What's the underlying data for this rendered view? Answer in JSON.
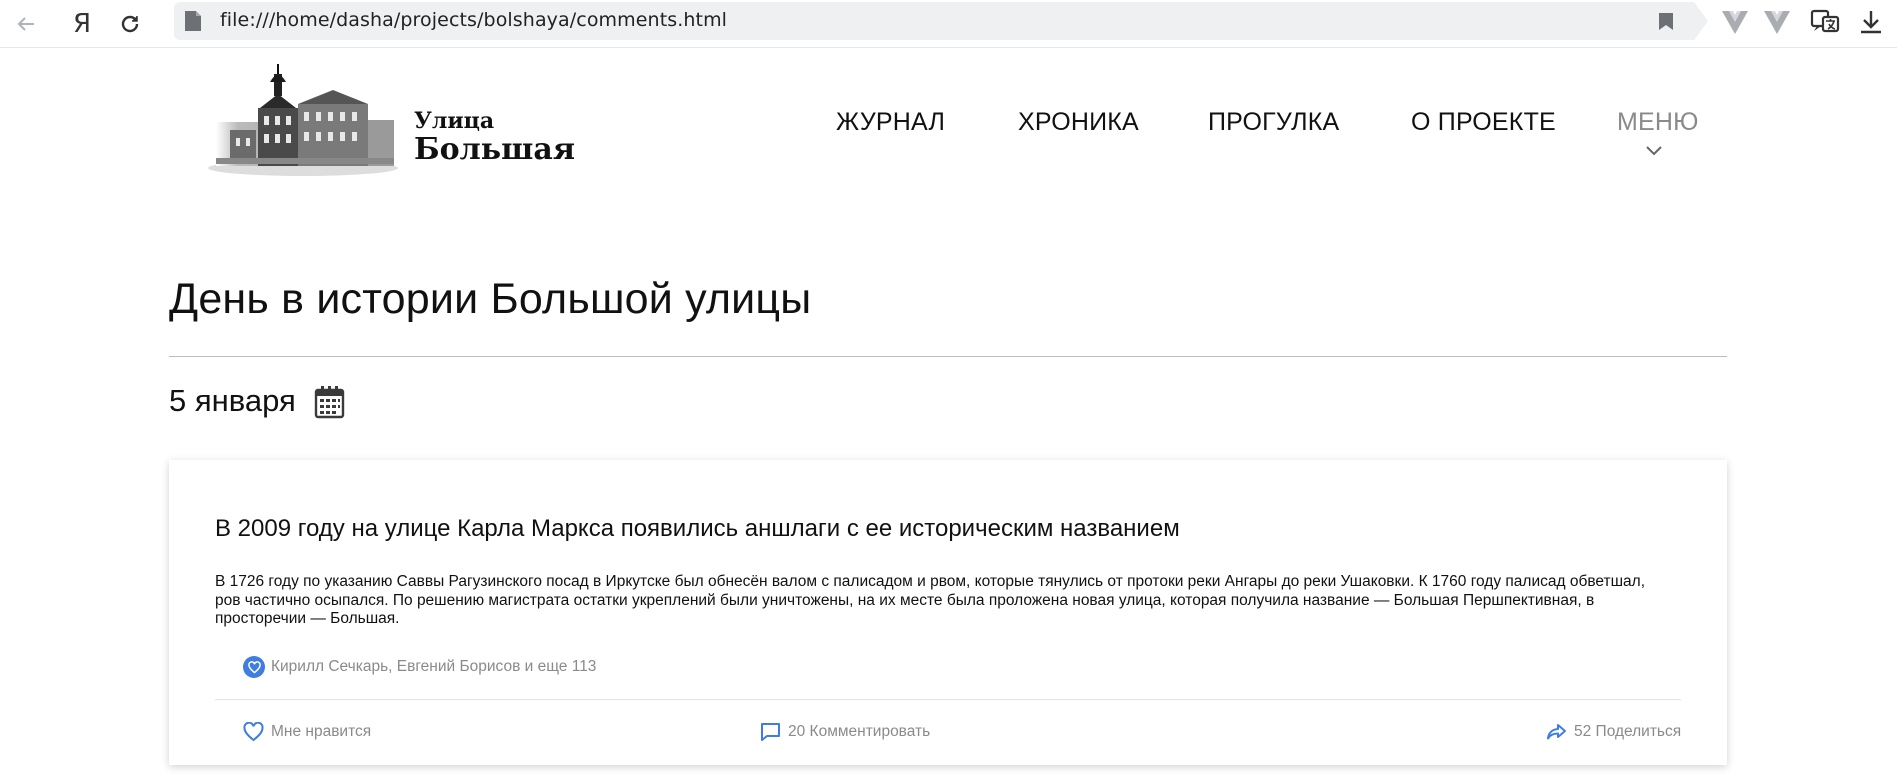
{
  "browser": {
    "url": "file:///home/dasha/projects/bolshaya/comments.html",
    "yandex_label": "Я"
  },
  "site": {
    "logo_line1": "Улица",
    "logo_line2": "Большая",
    "nav": [
      {
        "label": "ЖУРНАЛ"
      },
      {
        "label": "ХРОНИКА"
      },
      {
        "label": "ПРОГУЛКА"
      },
      {
        "label": "О ПРОЕКТЕ"
      },
      {
        "label": "МЕНЮ"
      }
    ]
  },
  "page": {
    "title": "День в истории Большой улицы",
    "date": "5 января"
  },
  "card": {
    "title": "В 2009 году на улице Карла Маркса появились аншлаги с ее историческим названием",
    "text_line1": "В 1726 году по указанию Саввы Рагузинского посад в Иркутске был обнесён валом с палисадом и рвом, которые тянулись от протоки реки Ангары до реки Ушаковки. К 1760 году палисад обветшал,",
    "text_line2": "ров частично осыпался. По решению магистрата остатки укреплений были уничтожены, на их месте была проложена новая улица, которая получила название — Большая Першпективная, в",
    "text_line3": "просторечии — Большая.",
    "likes_text": "Кирилл Сечкарь, Евгений Борисов и еще 113",
    "like_label": "Мне нравится",
    "comment_label": "20 Комментировать",
    "share_label": "52 Поделиться"
  },
  "colors": {
    "accent": "#3f7de0",
    "muted_text": "#8a8a8a",
    "menu_text": "#8a8a8a"
  },
  "icons": [
    "back-arrow-icon",
    "reload-icon",
    "document-icon",
    "bookmark-icon",
    "vue-devtools-icon",
    "translate-icon",
    "download-icon",
    "calendar-icon",
    "heart-icon",
    "comment-icon",
    "share-icon",
    "chevron-down-icon"
  ]
}
